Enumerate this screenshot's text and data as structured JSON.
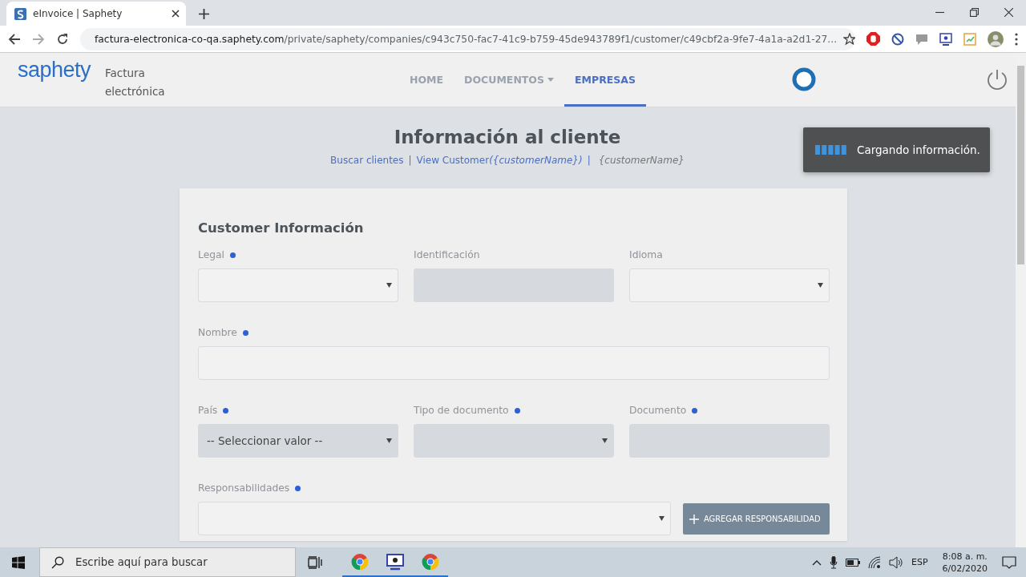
{
  "browser": {
    "tab_title": "eInvoice | Saphety",
    "url_host": "factura-electronica-co-qa.saphety.com",
    "url_path": "/private/saphety/companies/c943c750-fac7-41c9-b759-45de943789f1/customer/c49cbf2a-9fe7-4a1a-a2d1-27..."
  },
  "header": {
    "logo": "saphety",
    "product": "Factura electrónica",
    "nav": [
      {
        "label": "HOME",
        "selected": false,
        "dropdown": false
      },
      {
        "label": "DOCUMENTOS",
        "selected": false,
        "dropdown": true
      },
      {
        "label": "EMPRESAS",
        "selected": true,
        "dropdown": false
      }
    ]
  },
  "toast": {
    "message": "Cargando información."
  },
  "page": {
    "title": "Información al cliente",
    "separator": "|",
    "breadcrumbs": [
      {
        "label": "Buscar clientes",
        "link": true
      },
      {
        "label": "View Customer",
        "suffix": "({customerName})",
        "link": true
      },
      {
        "label": "{customerName}",
        "link": false
      }
    ]
  },
  "form": {
    "title": "Customer Información",
    "rows": [
      [
        {
          "label": "Legal",
          "required": true,
          "kind": "select",
          "disabled": false
        },
        {
          "label": "Identificación",
          "required": false,
          "kind": "text",
          "disabled": true
        },
        {
          "label": "Idioma",
          "required": false,
          "kind": "select",
          "disabled": false
        }
      ],
      [
        {
          "label": "Nombre",
          "required": true,
          "kind": "text",
          "disabled": false
        }
      ],
      [
        {
          "label": "País",
          "required": true,
          "kind": "select",
          "disabled": true,
          "value": "-- Seleccionar valor --"
        },
        {
          "label": "Tipo de documento",
          "required": true,
          "kind": "select",
          "disabled": true
        },
        {
          "label": "Documento",
          "required": true,
          "kind": "text",
          "disabled": true
        }
      ],
      [
        {
          "label": "Responsabilidades",
          "required": true,
          "kind": "select",
          "disabled": false
        }
      ]
    ],
    "add_button": "AGREGAR RESPONSABILIDAD"
  },
  "taskbar": {
    "search_placeholder": "Escribe aquí para buscar",
    "language": "ESP",
    "time": "8:08 a. m.",
    "date": "6/02/2020"
  }
}
